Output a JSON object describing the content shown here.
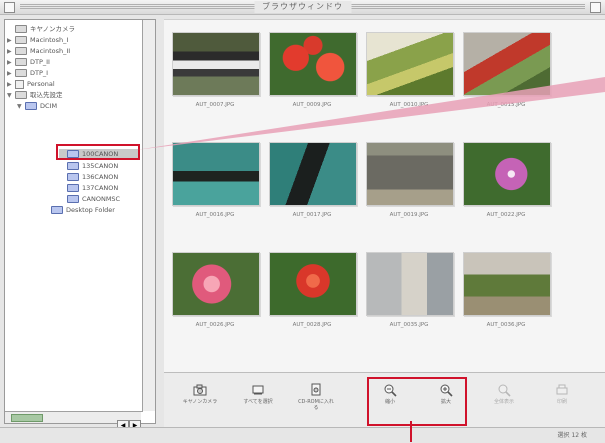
{
  "window": {
    "title": "ブラウザウィンドウ"
  },
  "sidebar": {
    "items": [
      {
        "label": "キヤノンカメラ",
        "expander": "",
        "icon": "camera"
      },
      {
        "label": "Macintosh_I",
        "expander": "▶",
        "icon": "drive"
      },
      {
        "label": "Macintosh_II",
        "expander": "▶",
        "icon": "drive"
      },
      {
        "label": "DTP_II",
        "expander": "▶",
        "icon": "drive"
      },
      {
        "label": "DTP_I",
        "expander": "▶",
        "icon": "drive"
      },
      {
        "label": "Personal",
        "expander": "▶",
        "icon": "person"
      },
      {
        "label": "取込先設定",
        "expander": "▼",
        "icon": "drive"
      },
      {
        "label": "DCIM",
        "expander": "▼",
        "icon": "folder"
      },
      {
        "label": "100CANON",
        "expander": "",
        "icon": "folder",
        "selected": true
      },
      {
        "label": "135CANON",
        "expander": "",
        "icon": "folder"
      },
      {
        "label": "136CANON",
        "expander": "",
        "icon": "folder"
      },
      {
        "label": "137CANON",
        "expander": "",
        "icon": "folder"
      },
      {
        "label": "CANONMSC",
        "expander": "",
        "icon": "folder"
      },
      {
        "label": "Desktop Folder",
        "expander": "",
        "icon": "folder"
      }
    ]
  },
  "thumbnails": [
    {
      "label": "AUT_0007.JPG"
    },
    {
      "label": "AUT_0009.JPG"
    },
    {
      "label": "AUT_0010.JPG"
    },
    {
      "label": "AUT_0015.JPG"
    },
    {
      "label": "AUT_0016.JPG"
    },
    {
      "label": "AUT_0017.JPG"
    },
    {
      "label": "AUT_0019.JPG"
    },
    {
      "label": "AUT_0022.JPG"
    },
    {
      "label": "AUT_0026.JPG"
    },
    {
      "label": "AUT_0028.JPG"
    },
    {
      "label": "AUT_0035.JPG"
    },
    {
      "label": "AUT_0036.JPG"
    }
  ],
  "toolbar": {
    "items": [
      {
        "label": "キヤノンカメラ",
        "icon": "camera-icon",
        "enabled": true
      },
      {
        "label": "すべてを選択",
        "icon": "select-all-icon",
        "enabled": true
      },
      {
        "label": "CD-ROMに入れる",
        "icon": "cd-icon",
        "enabled": true
      },
      {
        "label": "縮小",
        "icon": "zoom-out-icon",
        "enabled": true
      },
      {
        "label": "拡大",
        "icon": "zoom-in-icon",
        "enabled": true
      },
      {
        "label": "全体表示",
        "icon": "zoom-fit-icon",
        "enabled": false
      },
      {
        "label": "印刷",
        "icon": "print-icon",
        "enabled": false
      }
    ]
  },
  "status": {
    "text": "選択 12 枚"
  },
  "colors": {
    "callout": "#d0122b",
    "callout_line_pink": "#e7a0b6",
    "selection": "#c9c9c9"
  }
}
